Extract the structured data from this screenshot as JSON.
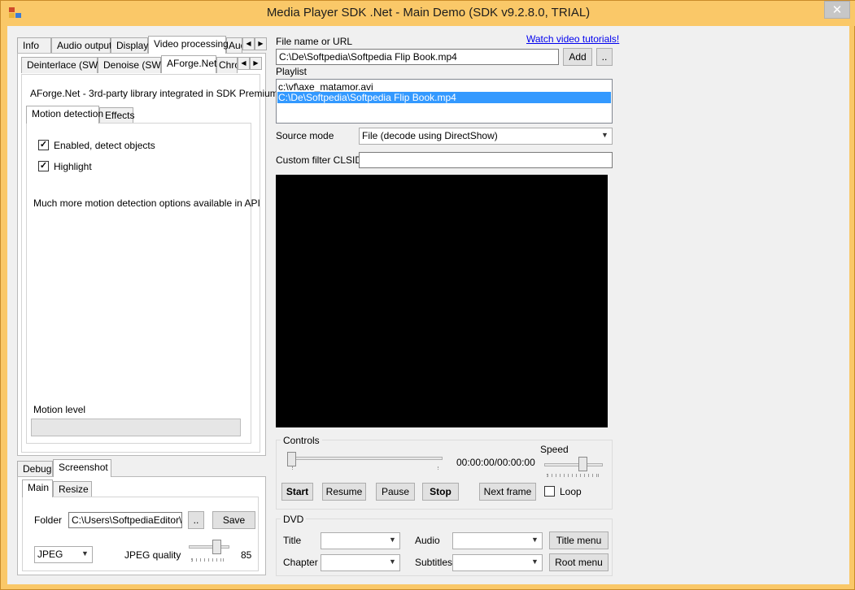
{
  "window": {
    "title": "Media Player SDK .Net - Main Demo (SDK v9.2.8.0, TRIAL)",
    "close_glyph": "✕"
  },
  "left_tabs": {
    "items": [
      "Info",
      "Audio output",
      "Display",
      "Video processing",
      "Aud"
    ],
    "selected": "Video processing"
  },
  "sub_tabs": {
    "items": [
      "Deinterlace (SW)",
      "Denoise (SW)",
      "AForge.Net",
      "Chro"
    ],
    "selected": "AForge.Net"
  },
  "aforge": {
    "description": "AForge.Net - 3rd-party library integrated in SDK Premium",
    "tabs": [
      "Motion detection",
      "Effects"
    ],
    "enabled_label": "Enabled, detect objects",
    "enabled_checked": true,
    "highlight_label": "Highlight",
    "highlight_checked": true,
    "more_options": "Much more motion detection options available in API",
    "motion_level_label": "Motion level",
    "motion_level_value": 0
  },
  "bottom_tabs": {
    "items": [
      "Debug",
      "Screenshot"
    ],
    "selected": "Screenshot",
    "inner_tabs": [
      "Main",
      "Resize"
    ],
    "inner_selected": "Main"
  },
  "screenshot": {
    "folder_label": "Folder",
    "folder_value": "C:\\Users\\SoftpediaEditor\\Do",
    "browse_label": "..",
    "save_label": "Save",
    "format_value": "JPEG",
    "quality_label": "JPEG quality",
    "quality_value": "85"
  },
  "source": {
    "file_label": "File name or URL",
    "tutorials_link": "Watch video tutorials!",
    "file_value": "C:\\De\\Softpedia\\Softpedia Flip Book.mp4",
    "add_label": "Add",
    "browse_label": "..",
    "playlist_label": "Playlist",
    "playlist_items": [
      "c:\\vf\\axe_matamor.avi",
      "C:\\De\\Softpedia\\Softpedia Flip Book.mp4"
    ],
    "playlist_selected": 1,
    "source_mode_label": "Source mode",
    "source_mode_value": "File (decode using DirectShow)",
    "clsid_label": "Custom filter CLSID",
    "clsid_value": ""
  },
  "controls": {
    "group_label": "Controls",
    "time": "00:00:00/00:00:00",
    "speed_label": "Speed",
    "position_fraction": 0,
    "speed_fraction": 0.6,
    "start_label": "Start",
    "resume_label": "Resume",
    "pause_label": "Pause",
    "stop_label": "Stop",
    "next_frame_label": "Next frame",
    "loop_label": "Loop",
    "loop_checked": false
  },
  "dvd": {
    "group_label": "DVD",
    "title_label": "Title",
    "audio_label": "Audio",
    "chapter_label": "Chapter",
    "subtitles_label": "Subtitles",
    "title_menu_label": "Title menu",
    "root_menu_label": "Root menu"
  },
  "colors": {
    "titlebar": "#fac868",
    "selection": "#3399ff",
    "video_bg": "#000000"
  }
}
